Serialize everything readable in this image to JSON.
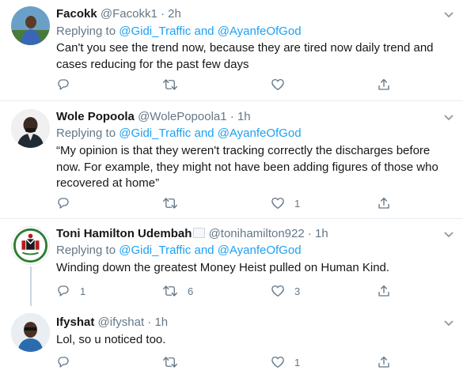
{
  "tweets": [
    {
      "name": "Facokk",
      "handle": "@Facokk1",
      "time": "2h",
      "replying_prefix": "Replying to ",
      "mention1": "@Gidi_Traffic",
      "and": " and ",
      "mention2": "@AyanfeOfGod",
      "text": "Can't you see the trend now, because they are tired now daily trend and cases reducing for the past few days",
      "replies": "",
      "retweets": "",
      "likes": ""
    },
    {
      "name": "Wole Popoola",
      "handle": "@WolePopoola1",
      "time": "1h",
      "replying_prefix": "Replying to ",
      "mention1": "@Gidi_Traffic",
      "and": " and ",
      "mention2": "@AyanfeOfGod",
      "text": "“My opinion is that they weren't tracking correctly the discharges before now. For example, they might not have been adding figures of those who recovered at home”",
      "replies": "",
      "retweets": "",
      "likes": "1"
    },
    {
      "name": "Toni Hamilton Udembah",
      "handle": "@tonihamilton922",
      "time": "1h",
      "replying_prefix": "Replying to ",
      "mention1": "@Gidi_Traffic",
      "and": " and ",
      "mention2": "@AyanfeOfGod",
      "text": "Winding down the greatest Money Heist pulled on Human Kind.",
      "replies": "1",
      "retweets": "6",
      "likes": "3"
    },
    {
      "name": "Ifyshat",
      "handle": "@ifyshat",
      "time": "1h",
      "text": "Lol, so u noticed too.",
      "replies": "",
      "retweets": "",
      "likes": "1"
    }
  ],
  "separator": " · ",
  "icons": {
    "reply": "reply-icon",
    "retweet": "retweet-icon",
    "like": "heart-icon",
    "share": "share-icon",
    "more": "more-chevron-icon",
    "flag": "flag-emoji-icon"
  },
  "colors": {
    "link": "#1da1f2",
    "muted": "#657786",
    "divider": "#e6ecf0",
    "text": "#14171a"
  }
}
